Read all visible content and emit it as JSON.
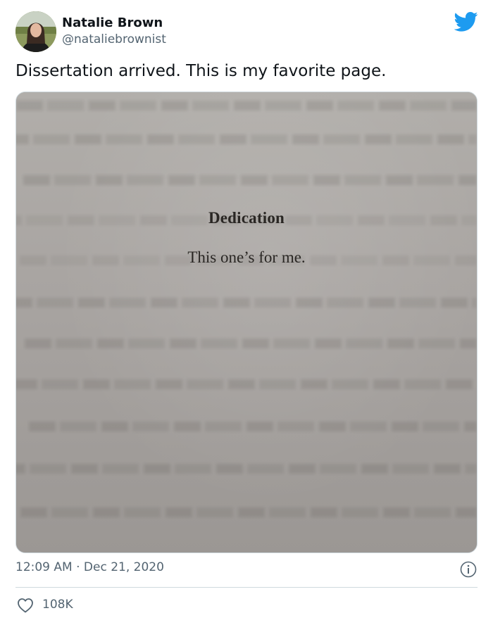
{
  "author": {
    "name": "Natalie Brown",
    "handle": "@nataliebrownist"
  },
  "tweet": {
    "text": "Dissertation arrived. This is my favorite page.",
    "timestamp": "12:09 AM · Dec 21, 2020"
  },
  "media": {
    "heading": "Dedication",
    "body": "This one’s for me."
  },
  "engagement": {
    "likes": "108K"
  },
  "icons": {
    "brand": "twitter-bird-icon",
    "info": "info-icon",
    "like": "heart-icon"
  },
  "colors": {
    "brand": "#1d9bf0",
    "text": "#0f1419",
    "muted": "#536471",
    "border": "#cfd9de"
  }
}
